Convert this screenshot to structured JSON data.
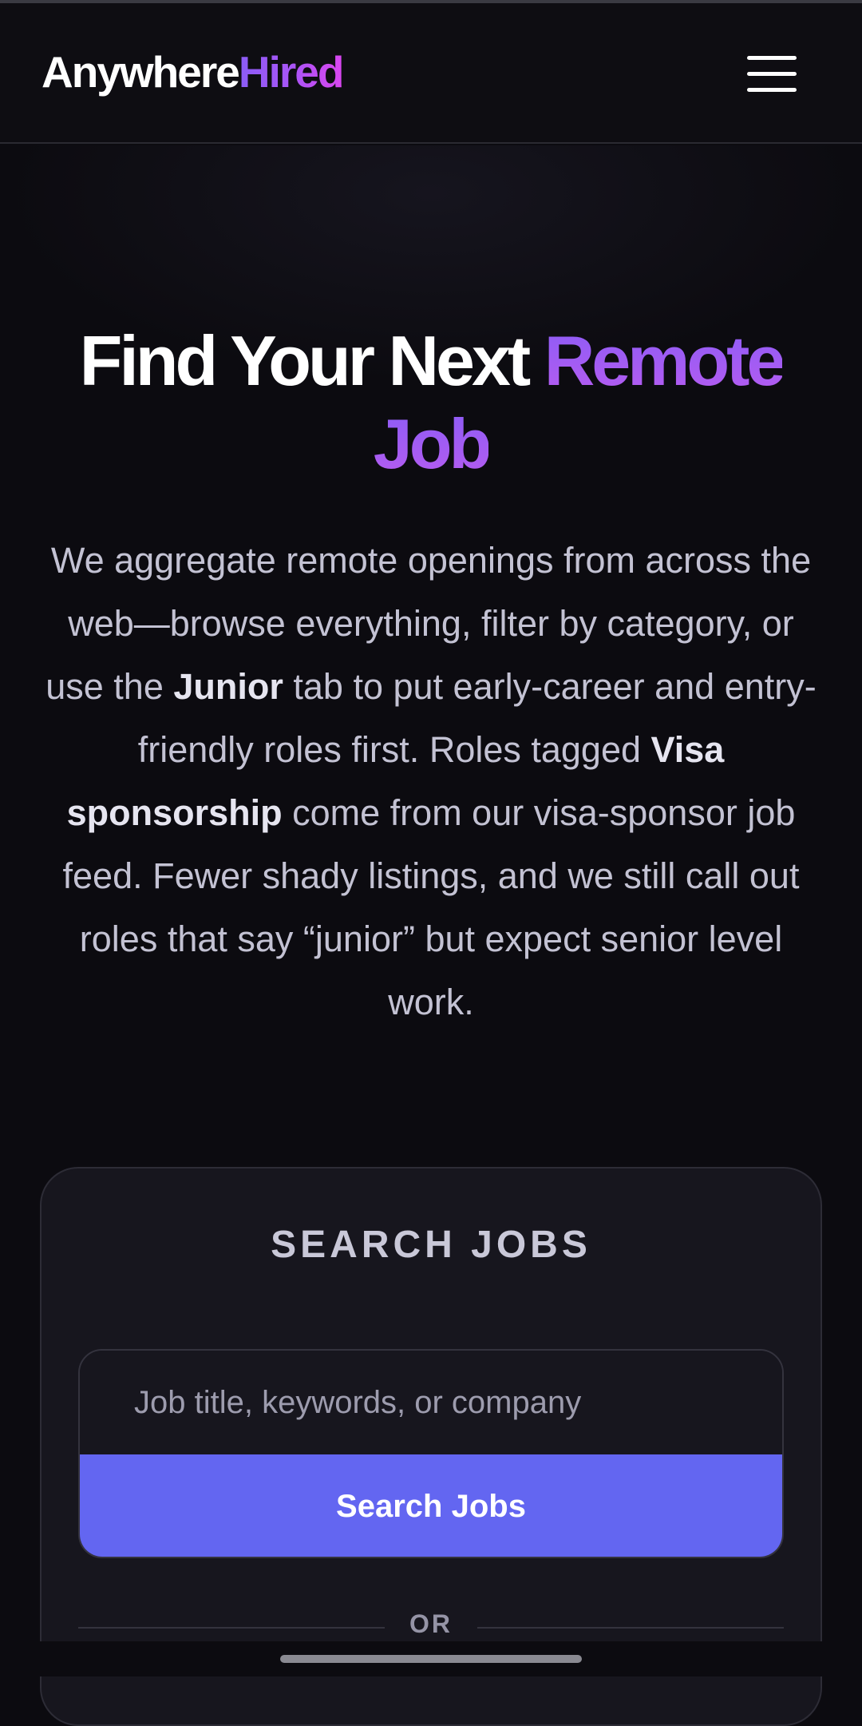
{
  "header": {
    "logo_part1": "Anywhere",
    "logo_part2": "Hired",
    "menu_icon": "hamburger-menu-icon"
  },
  "hero": {
    "title_plain": "Find Your Next ",
    "title_highlight": "Remote Job",
    "lead": {
      "p1": "We aggregate remote openings from across the web—browse everything, filter by category, or use the ",
      "b1": "Junior",
      "p2": " tab to put early-career and entry-friendly roles first. Roles tagged ",
      "b2": "Visa sponsorship",
      "p3": " come from our visa-sponsor job feed. Fewer shady listings, and we still call out roles that say “junior” but expect senior level work."
    }
  },
  "search_card": {
    "title": "SEARCH JOBS",
    "input_placeholder": "Job title, keywords, or company",
    "input_value": "",
    "button_label": "Search Jobs",
    "divider_text": "OR"
  },
  "colors": {
    "background": "#0c0b10",
    "accent": "#6366f1",
    "gradient_start": "#8b5cf6",
    "gradient_end": "#d946ef"
  }
}
